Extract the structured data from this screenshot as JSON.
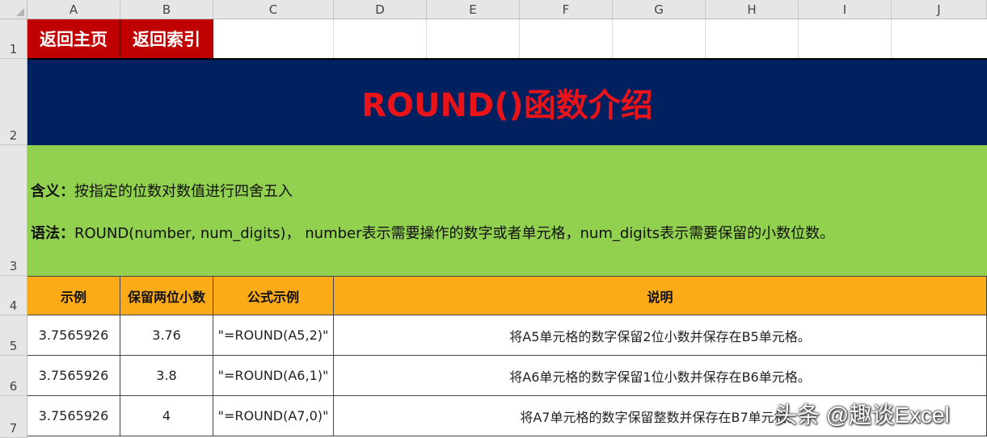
{
  "columns": [
    "A",
    "B",
    "C",
    "D",
    "E",
    "F",
    "G",
    "H",
    "I",
    "J"
  ],
  "rows": [
    "1",
    "2",
    "3",
    "4",
    "5",
    "6",
    "7"
  ],
  "nav": {
    "home_label": "返回主页",
    "index_label": "返回索引"
  },
  "title": "ROUND()函数介绍",
  "description": {
    "meaning_label": "含义：",
    "meaning_text": "按指定的位数对数值进行四舍五入",
    "syntax_label": "语法：",
    "syntax_text": "ROUND(number, num_digits)， number表示需要操作的数字或者单元格，num_digits表示需要保留的小数位数。"
  },
  "table": {
    "headers": [
      "示例",
      "保留两位小数",
      "公式示例",
      "说明"
    ],
    "rows": [
      [
        "3.7565926",
        "3.76",
        "\"=ROUND(A5,2)\"",
        "将A5单元格的数字保留2位小数并保存在B5单元格。"
      ],
      [
        "3.7565926",
        "3.8",
        "\"=ROUND(A6,1)\"",
        "将A6单元格的数字保留1位小数并保存在B6单元格。"
      ],
      [
        "3.7565926",
        "4",
        "\"=ROUND(A7,0)\"",
        "将A7单元格的数字保留整数并保存在B7单元格。"
      ]
    ]
  },
  "watermark": "头条 @趣谈Excel",
  "colors": {
    "button_red": "#c00000",
    "title_navy": "#002060",
    "title_red": "#e8141a",
    "band_green": "#92d050",
    "header_orange": "#fbab17"
  }
}
